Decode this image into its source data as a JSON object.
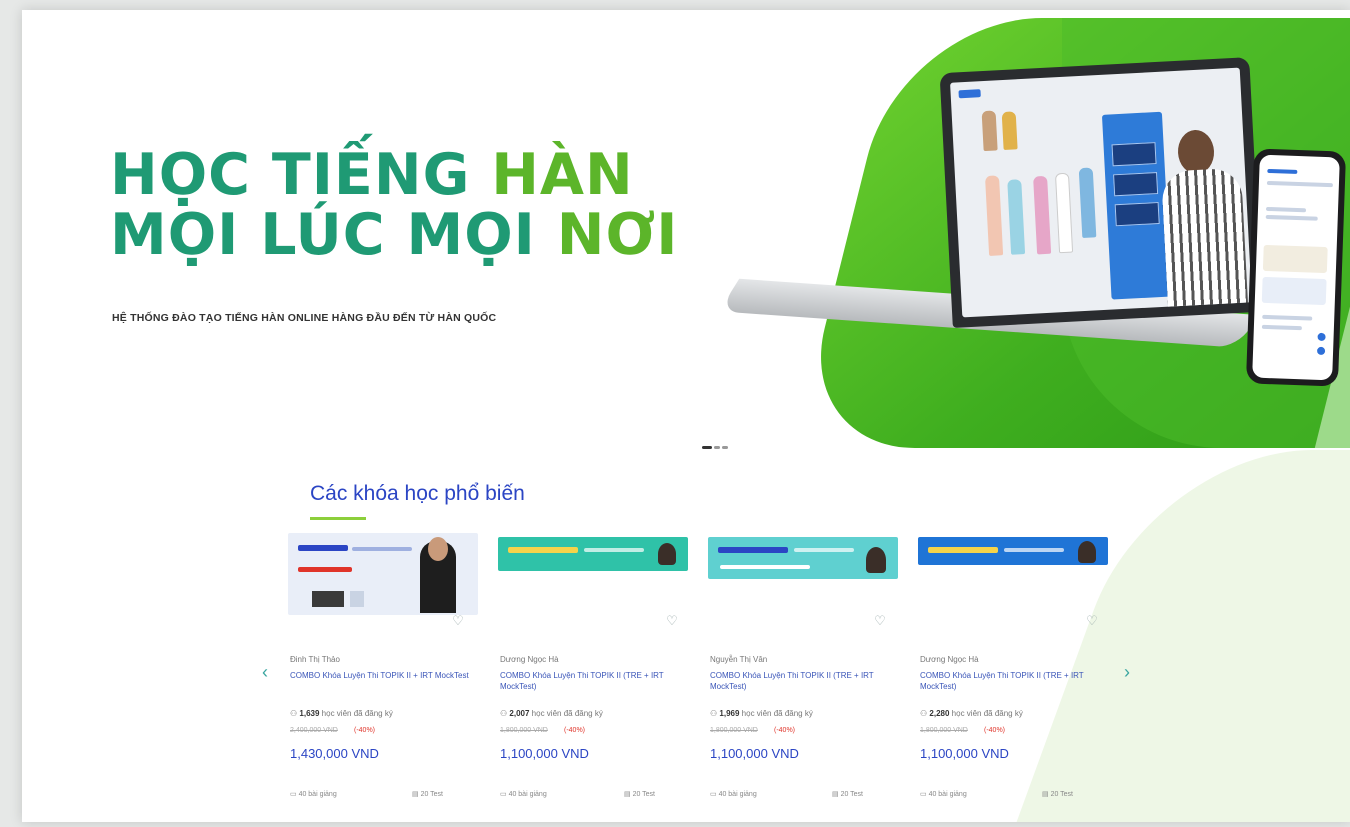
{
  "hero": {
    "title_line1_a": "HỌC TIẾNG ",
    "title_line1_b": "HÀN",
    "title_line2_a": "MỌI LÚC MỌI ",
    "title_line2_b": "NƠI",
    "subtitle": "HỆ THỐNG ĐÀO TẠO TIẾNG HÀN ONLINE HÀNG ĐẦU ĐẾN TỪ HÀN QUỐC",
    "colors": {
      "primary": "#1f9a74",
      "accent": "#5cb52a",
      "green_bg": "#4cbc2a"
    }
  },
  "courses": {
    "section_title": "Các khóa học phổ biến",
    "prev_icon": "‹",
    "next_icon": "›",
    "heart_icon": "♡",
    "items": [
      {
        "teacher": "Đinh Thị Thảo",
        "name": "COMBO Khóa Luyện Thi TOPIK II + IRT MockTest",
        "students_count": "1,639",
        "students_text": "học viên đã đăng ký",
        "old_price": "2,400,000 VND",
        "discount": "(-40%)",
        "price": "1,430,000 VND",
        "lessons": "40 bài giảng",
        "tests": "20 Test",
        "thumb_color": "#e9eef8"
      },
      {
        "teacher": "Dương Ngọc Hà",
        "name": "COMBO Khóa Luyện Thi TOPIK II (TRE + IRT MockTest)",
        "students_count": "2,007",
        "students_text": "học viên đã đăng ký",
        "old_price": "1,800,000 VND",
        "discount": "(-40%)",
        "price": "1,100,000 VND",
        "lessons": "40 bài giảng",
        "tests": "20 Test",
        "thumb_color": "#2fc2a8"
      },
      {
        "teacher": "Nguyễn Thị Vân",
        "name": "COMBO Khóa Luyện Thi TOPIK II (TRE + IRT MockTest)",
        "students_count": "1,969",
        "students_text": "học viên đã đăng ký",
        "old_price": "1,800,000 VND",
        "discount": "(-40%)",
        "price": "1,100,000 VND",
        "lessons": "40 bài giảng",
        "tests": "20 Test",
        "thumb_color": "#5fd0d0"
      },
      {
        "teacher": "Dương Ngọc Hà",
        "name": "COMBO Khóa Luyện Thi TOPIK II (TRE + IRT MockTest)",
        "students_count": "2,280",
        "students_text": "học viên đã đăng ký",
        "old_price": "1,800,000 VND",
        "discount": "(-40%)",
        "price": "1,100,000 VND",
        "lessons": "40 bài giảng",
        "tests": "20 Test",
        "thumb_color": "#1f74d6"
      }
    ]
  }
}
